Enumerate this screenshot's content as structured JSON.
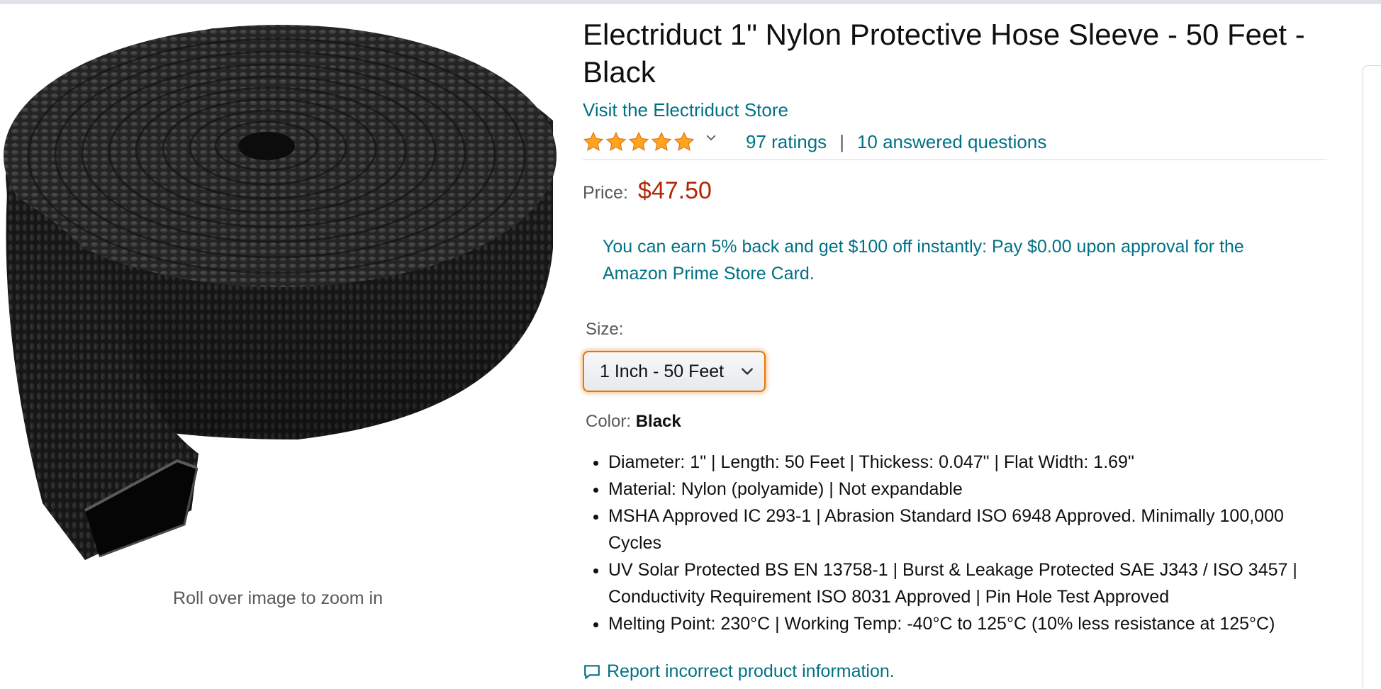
{
  "product": {
    "title": "Electriduct 1\" Nylon Protective Hose Sleeve - 50 Feet - Black",
    "store_link": "Visit the Electriduct Store",
    "rating": {
      "stars": 5,
      "ratings_text": "97 ratings",
      "separator": "|",
      "questions_text": "10 answered questions"
    },
    "price": {
      "label": "Price:",
      "value": "$47.50"
    },
    "promo": "You can earn 5% back and get $100 off instantly: Pay $0.00 upon approval for the Amazon Prime Store Card.",
    "size": {
      "label": "Size:",
      "selected": "1 Inch - 50 Feet"
    },
    "color": {
      "label": "Color:",
      "value": "Black"
    },
    "bullets": [
      "Diameter: 1\" | Length: 50 Feet | Thickess: 0.047\" | Flat Width: 1.69\"",
      "Material: Nylon (polyamide) | Not expandable",
      "MSHA Approved IC 293-1 | Abrasion Standard ISO 6948 Approved. Minimally 100,000 Cycles",
      "UV Solar Protected BS EN 13758-1 | Burst & Leakage Protected SAE J343 / ISO 3457 | Conductivity Requirement ISO 8031 Approved | Pin Hole Test Approved",
      "Melting Point: 230°C | Working Temp: -40°C to 125°C (10% less resistance at 125°C)"
    ],
    "report_link": "Report incorrect product information."
  },
  "image_panel": {
    "zoom_hint": "Roll over image to zoom in",
    "image_icon": "black-nylon-hose-roll"
  },
  "colors": {
    "link": "#007185",
    "price": "#b12704",
    "star": "#ffa41c",
    "select_focus": "#e77600"
  }
}
